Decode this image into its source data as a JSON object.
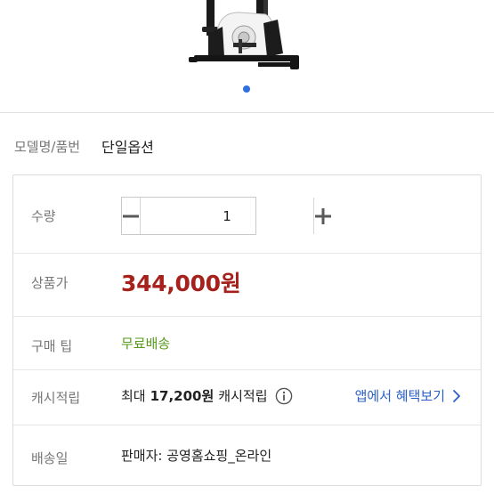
{
  "product_image": {
    "icon": "exercise-bike-image"
  },
  "carousel": {
    "active_index": 1,
    "total": 1,
    "dot_color": "#2f6fe0"
  },
  "model": {
    "label": "모델명/품번",
    "value": "단일옵션"
  },
  "options": {
    "quantity": {
      "label": "수량",
      "value": "1",
      "minus_icon": "minus-icon",
      "plus_icon": "plus-icon"
    },
    "price": {
      "label": "상품가",
      "value": "344,000원",
      "color": "#a6201c"
    },
    "tip": {
      "label": "구매 팁",
      "value": "무료배송",
      "color": "#5a9a1e"
    },
    "cashback": {
      "label": "캐시적립",
      "prefix": "최대",
      "amount": "17,200원",
      "suffix": "캐시적립",
      "info_icon": "info-icon",
      "link_label": "앱에서 혜택보기",
      "link_color": "#2b5fc7"
    },
    "shipping": {
      "label": "배송일",
      "value": "판매자: 공영홈쇼핑_온라인"
    }
  }
}
